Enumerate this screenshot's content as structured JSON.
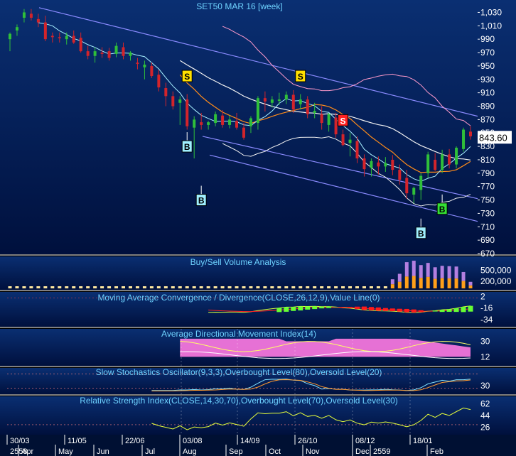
{
  "colors": {
    "panel_top": "#0a2f72",
    "panel_bottom": "#00103d",
    "title_text": "#6fd3ff",
    "axis_text": "#ffffff",
    "candle_up": "#2fbf3a",
    "candle_down": "#d3242b",
    "trend_channel": "#8b8bff",
    "ma_orange": "#ff8c1a",
    "ma_pink": "#ff9acb",
    "ma_white": "#f2f2f2",
    "ma_cyan": "#a8f0ff",
    "price_tag_bg": "#ffffff",
    "adx_fill": "#ff7ae2",
    "signal_s": "#ffe000",
    "signal_s_red": "#ff2222",
    "signal_b": "#9fefff",
    "signal_b_green": "#34e034"
  },
  "chart_data": [
    {
      "type": "candlestick",
      "title": "SET50 MAR 16  [week]",
      "ylim": [
        670,
        1040
      ],
      "yticks": [
        "1,030",
        "1,010",
        "990",
        "970",
        "950",
        "930",
        "910",
        "890",
        "870",
        "850",
        "830",
        "810",
        "790",
        "770",
        "750",
        "730",
        "710",
        "690",
        "670"
      ],
      "last_price_label": "843.60",
      "x_date_labels": [
        "30/03",
        "11/05",
        "22/06",
        "03/08",
        "14/09",
        "26/10",
        "08/12",
        "18/01"
      ],
      "x_month_labels": [
        "Apr",
        "May",
        "Jun",
        "Jul",
        "Aug",
        "Sep",
        "Oct",
        "Nov",
        "Dec",
        "2559",
        "Feb"
      ],
      "x_year_label": "2558",
      "candles": [
        {
          "o": 990,
          "h": 1000,
          "l": 972,
          "c": 998
        },
        {
          "o": 1003,
          "h": 1012,
          "l": 995,
          "c": 1008
        },
        {
          "o": 1022,
          "h": 1035,
          "l": 1015,
          "c": 1030
        },
        {
          "o": 1028,
          "h": 1035,
          "l": 1018,
          "c": 1022
        },
        {
          "o": 1020,
          "h": 1028,
          "l": 1008,
          "c": 1015
        },
        {
          "o": 1015,
          "h": 1025,
          "l": 987,
          "c": 990
        },
        {
          "o": 995,
          "h": 1000,
          "l": 985,
          "c": 993
        },
        {
          "o": 993,
          "h": 1000,
          "l": 985,
          "c": 992
        },
        {
          "o": 990,
          "h": 1000,
          "l": 982,
          "c": 995
        },
        {
          "o": 995,
          "h": 1003,
          "l": 983,
          "c": 985
        },
        {
          "o": 992,
          "h": 1000,
          "l": 970,
          "c": 972
        },
        {
          "o": 972,
          "h": 980,
          "l": 960,
          "c": 965
        },
        {
          "o": 965,
          "h": 978,
          "l": 955,
          "c": 972
        },
        {
          "o": 970,
          "h": 978,
          "l": 962,
          "c": 968
        },
        {
          "o": 972,
          "h": 977,
          "l": 958,
          "c": 962
        },
        {
          "o": 968,
          "h": 985,
          "l": 963,
          "c": 980
        },
        {
          "o": 978,
          "h": 985,
          "l": 960,
          "c": 965
        },
        {
          "o": 965,
          "h": 972,
          "l": 958,
          "c": 970
        },
        {
          "o": 955,
          "h": 962,
          "l": 945,
          "c": 953
        },
        {
          "o": 948,
          "h": 958,
          "l": 930,
          "c": 952
        },
        {
          "o": 950,
          "h": 955,
          "l": 932,
          "c": 935
        },
        {
          "o": 937,
          "h": 944,
          "l": 912,
          "c": 918
        },
        {
          "o": 917,
          "h": 925,
          "l": 890,
          "c": 905
        },
        {
          "o": 905,
          "h": 912,
          "l": 885,
          "c": 890
        },
        {
          "o": 895,
          "h": 905,
          "l": 862,
          "c": 900
        },
        {
          "o": 900,
          "h": 908,
          "l": 855,
          "c": 860
        },
        {
          "o": 858,
          "h": 875,
          "l": 812,
          "c": 870
        },
        {
          "o": 866,
          "h": 880,
          "l": 855,
          "c": 862
        },
        {
          "o": 862,
          "h": 868,
          "l": 855,
          "c": 866
        },
        {
          "o": 865,
          "h": 882,
          "l": 860,
          "c": 878
        },
        {
          "o": 876,
          "h": 884,
          "l": 858,
          "c": 862
        },
        {
          "o": 862,
          "h": 876,
          "l": 857,
          "c": 870
        },
        {
          "o": 868,
          "h": 880,
          "l": 855,
          "c": 858
        },
        {
          "o": 858,
          "h": 865,
          "l": 840,
          "c": 843
        },
        {
          "o": 860,
          "h": 875,
          "l": 850,
          "c": 872
        },
        {
          "o": 865,
          "h": 905,
          "l": 855,
          "c": 902
        },
        {
          "o": 902,
          "h": 912,
          "l": 882,
          "c": 897
        },
        {
          "o": 895,
          "h": 905,
          "l": 888,
          "c": 900
        },
        {
          "o": 898,
          "h": 910,
          "l": 892,
          "c": 900
        },
        {
          "o": 900,
          "h": 912,
          "l": 893,
          "c": 907
        },
        {
          "o": 907,
          "h": 914,
          "l": 880,
          "c": 885
        },
        {
          "o": 893,
          "h": 908,
          "l": 885,
          "c": 900
        },
        {
          "o": 900,
          "h": 905,
          "l": 872,
          "c": 878
        },
        {
          "o": 880,
          "h": 895,
          "l": 872,
          "c": 883
        },
        {
          "o": 878,
          "h": 890,
          "l": 855,
          "c": 865
        },
        {
          "o": 862,
          "h": 880,
          "l": 852,
          "c": 878
        },
        {
          "o": 873,
          "h": 880,
          "l": 843,
          "c": 848
        },
        {
          "o": 848,
          "h": 855,
          "l": 830,
          "c": 832
        },
        {
          "o": 835,
          "h": 850,
          "l": 815,
          "c": 840
        },
        {
          "o": 838,
          "h": 845,
          "l": 805,
          "c": 812
        },
        {
          "o": 812,
          "h": 818,
          "l": 785,
          "c": 796
        },
        {
          "o": 798,
          "h": 812,
          "l": 785,
          "c": 808
        },
        {
          "o": 806,
          "h": 815,
          "l": 788,
          "c": 800
        },
        {
          "o": 800,
          "h": 814,
          "l": 792,
          "c": 805
        },
        {
          "o": 810,
          "h": 817,
          "l": 787,
          "c": 795
        },
        {
          "o": 795,
          "h": 803,
          "l": 773,
          "c": 780
        },
        {
          "o": 783,
          "h": 795,
          "l": 752,
          "c": 760
        },
        {
          "o": 758,
          "h": 770,
          "l": 745,
          "c": 768
        },
        {
          "o": 765,
          "h": 790,
          "l": 750,
          "c": 786
        },
        {
          "o": 790,
          "h": 822,
          "l": 783,
          "c": 818
        },
        {
          "o": 810,
          "h": 820,
          "l": 793,
          "c": 795
        },
        {
          "o": 795,
          "h": 825,
          "l": 790,
          "c": 818
        },
        {
          "o": 818,
          "h": 826,
          "l": 797,
          "c": 803
        },
        {
          "o": 803,
          "h": 830,
          "l": 797,
          "c": 828
        },
        {
          "o": 826,
          "h": 858,
          "l": 822,
          "c": 855
        },
        {
          "o": 852,
          "h": 860,
          "l": 840,
          "c": 845
        }
      ],
      "signals": [
        {
          "label": "S",
          "style": "yellow",
          "index": 25,
          "price": 935
        },
        {
          "label": "S",
          "style": "yellow",
          "index": 41,
          "price": 935
        },
        {
          "label": "S",
          "style": "red",
          "index": 47,
          "price": 869
        },
        {
          "label": "B",
          "style": "cyan",
          "index": 25,
          "price": 830
        },
        {
          "label": "B",
          "style": "cyan",
          "index": 27,
          "price": 750
        },
        {
          "label": "B",
          "style": "cyan",
          "index": 58,
          "price": 701
        },
        {
          "label": "B",
          "style": "green",
          "index": 61,
          "price": 737
        }
      ]
    },
    {
      "type": "bar",
      "title": "Buy/Sell Volume Analysis",
      "yticks": [
        "500,000",
        "200,000"
      ],
      "values": [
        120000,
        110000,
        120000,
        100000,
        110000,
        110000,
        100000,
        110000,
        100000,
        110000,
        120000,
        100000,
        110000,
        100000,
        110000,
        100000,
        110000,
        100000,
        120000,
        110000,
        100000,
        110000,
        120000,
        100000,
        110000,
        100000,
        110000,
        100000,
        110000,
        120000,
        110000,
        100000,
        110000,
        100000,
        110000,
        100000,
        110000,
        120000,
        100000,
        110000,
        100000,
        110000,
        100000,
        110000,
        100000,
        110000,
        100000,
        110000,
        100000,
        110000,
        100000,
        110000,
        120000,
        100000,
        250000,
        400000,
        720000,
        760000,
        640000,
        700000,
        580000,
        620000,
        610000,
        600000,
        450000,
        180000
      ],
      "buy_share": 0.45
    },
    {
      "type": "line",
      "title": "Moving Average Convergence / Divergence(CLOSE,26,12,9),Value Line(0)",
      "yticks": [
        "2",
        "-16",
        "-34"
      ],
      "ylim": [
        -42,
        6
      ]
    },
    {
      "type": "area",
      "title": "Average Directional Movement Index(14)",
      "yticks": [
        "30",
        "12"
      ],
      "ylim": [
        4,
        42
      ]
    },
    {
      "type": "line",
      "title": "Slow Stochastics Oscillator(9,3,3),Overbought Level(80),Oversold Level(20)",
      "yticks": [
        "30"
      ],
      "ylim": [
        0,
        100
      ]
    },
    {
      "type": "line",
      "title": "Relative Strength Index(CLOSE,14,30,70),Overbought Level(70),Oversold Level(30)",
      "yticks": [
        "62",
        "44",
        "26"
      ],
      "ylim": [
        18,
        70
      ]
    }
  ]
}
